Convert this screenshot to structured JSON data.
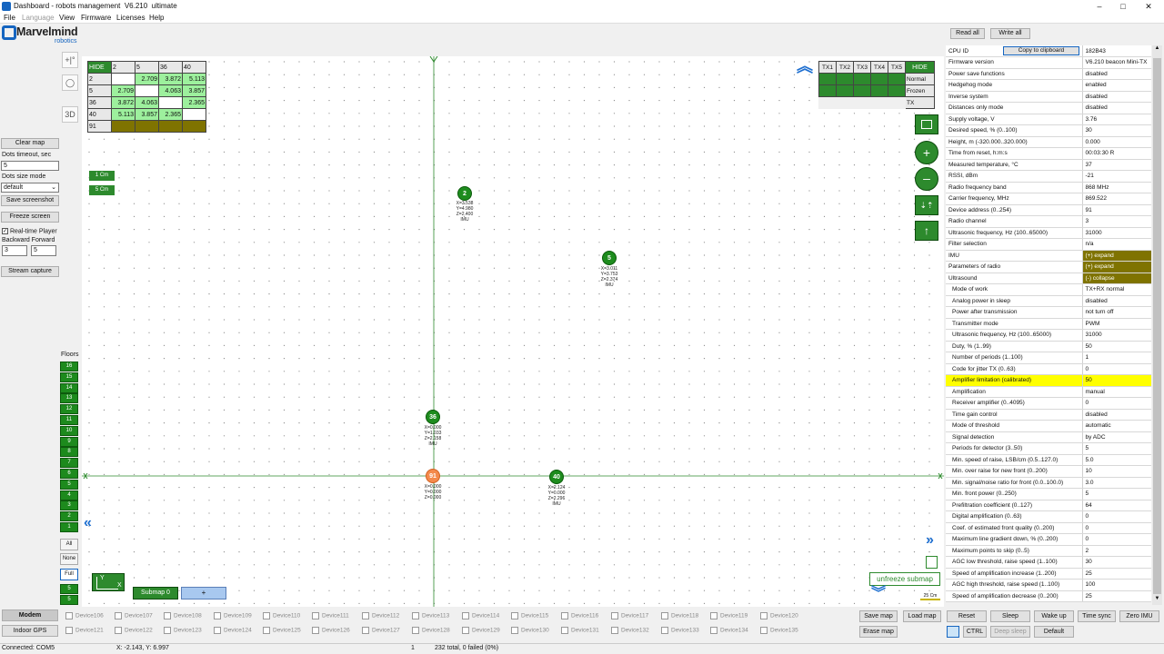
{
  "window": {
    "title": "Dashboard - robots management  V6.210  ultimate",
    "min": "–",
    "max": "□",
    "close": "✕"
  },
  "menu": [
    {
      "label": "File"
    },
    {
      "label": "Language"
    },
    {
      "label": "View"
    },
    {
      "label": "Firmware"
    },
    {
      "label": "Licenses"
    },
    {
      "label": "Help"
    }
  ],
  "logo": {
    "name": "Marvelmind",
    "sub": "robotics"
  },
  "left": {
    "clear_map": "Clear map",
    "dots_timeout_label": "Dots timeout, sec",
    "dots_timeout_value": "5",
    "dots_size_label": "Dots size mode",
    "dots_size_value": "default",
    "save_screenshot": "Save screenshot",
    "freeze_screen": "Freeze screen",
    "realtime_player": "Real-time Player",
    "backward_forward": "Backward Forward",
    "backward_value": "3",
    "forward_value": "5",
    "stream_capture": "Stream capture"
  },
  "tools": {
    "t1": "+|°",
    "t2": "◯",
    "t3": "3D"
  },
  "floors": {
    "title": "Floors",
    "items": [
      "16",
      "15",
      "14",
      "13",
      "12",
      "11",
      "10",
      "9",
      "8",
      "7",
      "6",
      "5",
      "4",
      "3",
      "2",
      "1"
    ],
    "all": "All",
    "none": "None",
    "full": "Full",
    "f1": "5",
    "f2": "5"
  },
  "distance_table": {
    "header": [
      "HIDE",
      "2",
      "5",
      "36",
      "40"
    ],
    "rows": [
      {
        "id": "2",
        "cells": [
          "",
          "2.709",
          "3.872",
          "5.113"
        ]
      },
      {
        "id": "5",
        "cells": [
          "2.709",
          "",
          "4.063",
          "3.857"
        ]
      },
      {
        "id": "36",
        "cells": [
          "3.872",
          "4.063",
          "",
          "2.365"
        ]
      },
      {
        "id": "40",
        "cells": [
          "5.113",
          "3.857",
          "2.365",
          ""
        ]
      },
      {
        "id": "91",
        "cells": [
          "",
          "",
          "",
          ""
        ]
      }
    ]
  },
  "tx_table": {
    "header": [
      "TX1",
      "TX2",
      "TX3",
      "TX4",
      "TX5"
    ],
    "hide": "HIDE",
    "modes": [
      "Normal",
      "Frozen",
      "TX"
    ]
  },
  "map_badges": [
    "1 Cm",
    "5 Cm"
  ],
  "beacons": [
    {
      "id": "2",
      "info": [
        "X=3.538",
        "Y=4.980",
        "Z=2.400",
        "IMU"
      ]
    },
    {
      "id": "5",
      "info": [
        "X=3.011",
        "Y=3.753",
        "Z=2.374",
        "IMU"
      ]
    },
    {
      "id": "36",
      "info": [
        "X=0.000",
        "Y=1.033",
        "Z=2.158",
        "IMU"
      ]
    },
    {
      "id": "91",
      "info": [
        "X=0.000",
        "Y=0.000",
        "Z=0.000"
      ]
    },
    {
      "id": "40",
      "info": [
        "X=2.124",
        "Y=0.000",
        "Z=2.296",
        "IMU"
      ]
    }
  ],
  "axes": {
    "y": "Y",
    "x": "X"
  },
  "submap": {
    "label": "Submap 0",
    "add": "+"
  },
  "unfreeze": "unfreeze submap",
  "scale": "25 Cm",
  "right": {
    "read_all": "Read all",
    "write_all": "Write all",
    "copy": "Copy to clipboard",
    "props": [
      {
        "k": "CPU ID",
        "v": "182B43"
      },
      {
        "k": "Firmware version",
        "v": "V6.210 beacon Mini-TX"
      },
      {
        "k": "Power save functions",
        "v": "disabled"
      },
      {
        "k": "Hedgehog mode",
        "v": "enabled"
      },
      {
        "k": "Inverse system",
        "v": "disabled"
      },
      {
        "k": "Distances only mode",
        "v": "disabled"
      },
      {
        "k": "Supply voltage, V",
        "v": "3.76"
      },
      {
        "k": "Desired speed, % (0..100)",
        "v": "30"
      },
      {
        "k": "Height, m (-320.000..320.000)",
        "v": "0.000"
      },
      {
        "k": "Time from reset, h:m:s",
        "v": "00:03:30   R"
      },
      {
        "k": "Measured temperature, °C",
        "v": "37"
      },
      {
        "k": "RSSI, dBm",
        "v": "-21"
      },
      {
        "k": "Radio frequency band",
        "v": "868 MHz"
      },
      {
        "k": "Carrier frequency, MHz",
        "v": "869.522"
      },
      {
        "k": "Device address (0..254)",
        "v": "91"
      },
      {
        "k": "Radio channel",
        "v": "3"
      },
      {
        "k": "Ultrasonic frequency, Hz (100..65000)",
        "v": "31000"
      },
      {
        "k": "Filter selection",
        "v": "n/a"
      },
      {
        "k": "IMU",
        "v": "(+) expand",
        "style": "ol"
      },
      {
        "k": "Parameters of radio",
        "v": "(+) expand",
        "style": "ol"
      },
      {
        "k": "Ultrasound",
        "v": "(-) collapse",
        "style": "ol"
      },
      {
        "k": "Mode of work",
        "v": "TX+RX normal",
        "sub": true
      },
      {
        "k": "Analog power in sleep",
        "v": "disabled",
        "sub": true
      },
      {
        "k": "Power after transmission",
        "v": "not turn off",
        "sub": true
      },
      {
        "k": "Transmitter mode",
        "v": "PWM",
        "sub": true
      },
      {
        "k": "Ultrasonic frequency, Hz (100..65000)",
        "v": "31000",
        "sub": true
      },
      {
        "k": "Duty, % (1..99)",
        "v": "50",
        "sub": true
      },
      {
        "k": "Number of periods (1..100)",
        "v": "1",
        "sub": true
      },
      {
        "k": "Code for jitter TX (0..63)",
        "v": "0",
        "sub": true
      },
      {
        "k": "Amplifier limitation (calibrated)",
        "v": "50",
        "sub": true,
        "style": "yl"
      },
      {
        "k": "Amplification",
        "v": "manual",
        "sub": true
      },
      {
        "k": "Receiver amplifier (0..4095)",
        "v": "0",
        "sub": true
      },
      {
        "k": "Time gain control",
        "v": "disabled",
        "sub": true
      },
      {
        "k": "Mode of threshold",
        "v": "automatic",
        "sub": true
      },
      {
        "k": "Signal detection",
        "v": "by ADC",
        "sub": true
      },
      {
        "k": "Periods for detector (3..50)",
        "v": "5",
        "sub": true
      },
      {
        "k": "Min. speed of raise, LSB/cm (0.5..127.0)",
        "v": "5.0",
        "sub": true
      },
      {
        "k": "Min. over raise for new front (0..200)",
        "v": "10",
        "sub": true
      },
      {
        "k": "Min. signal/noise ratio for front (0.0..100.0)",
        "v": "3.0",
        "sub": true
      },
      {
        "k": "Min. front power (0..250)",
        "v": "5",
        "sub": true
      },
      {
        "k": "Prefiltration coefficient (0..127)",
        "v": "64",
        "sub": true
      },
      {
        "k": "Digital amplification (0..63)",
        "v": "0",
        "sub": true
      },
      {
        "k": "Coef. of estimated front quality (0..200)",
        "v": "0",
        "sub": true
      },
      {
        "k": "Maximum line gradient down, % (0..200)",
        "v": "0",
        "sub": true
      },
      {
        "k": "Maximum points to skip (0..5)",
        "v": "2",
        "sub": true
      },
      {
        "k": "AGC low threshold, raise speed (1..100)",
        "v": "30",
        "sub": true
      },
      {
        "k": "Speed of amplification increase (1..200)",
        "v": "25",
        "sub": true
      },
      {
        "k": "AGC high threshold, raise speed (1..100)",
        "v": "100",
        "sub": true
      },
      {
        "k": "Speed of amplification decrease (0..200)",
        "v": "25",
        "sub": true
      }
    ]
  },
  "bottom": {
    "modem": "Modem",
    "indoor_gps": "Indoor GPS",
    "devices_row1": [
      "Device106",
      "Device107",
      "Device108",
      "Device109",
      "Device110",
      "Device111",
      "Device112",
      "Device113",
      "Device114",
      "Device115",
      "Device116",
      "Device117",
      "Device118",
      "Device119",
      "Device120"
    ],
    "devices_row2": [
      "Device121",
      "Device122",
      "Device123",
      "Device124",
      "Device125",
      "Device126",
      "Device127",
      "Device128",
      "Device129",
      "Device130",
      "Device131",
      "Device132",
      "Device133",
      "Device134",
      "Device135"
    ],
    "save_map": "Save map",
    "load_map": "Load map",
    "erase_map": "Erase map",
    "reset": "Reset",
    "sleep": "Sleep",
    "wake_up": "Wake up",
    "time_sync": "Time sync",
    "zero_imu": "Zero IMU",
    "ctrl": "CTRL",
    "deep_sleep": "Deep sleep",
    "default": "Default"
  },
  "status": {
    "connected": "Connected: COM5",
    "coords": "X: -2.143, Y: 6.997",
    "count": "1",
    "summary": "232 total, 0 failed (0%)"
  }
}
